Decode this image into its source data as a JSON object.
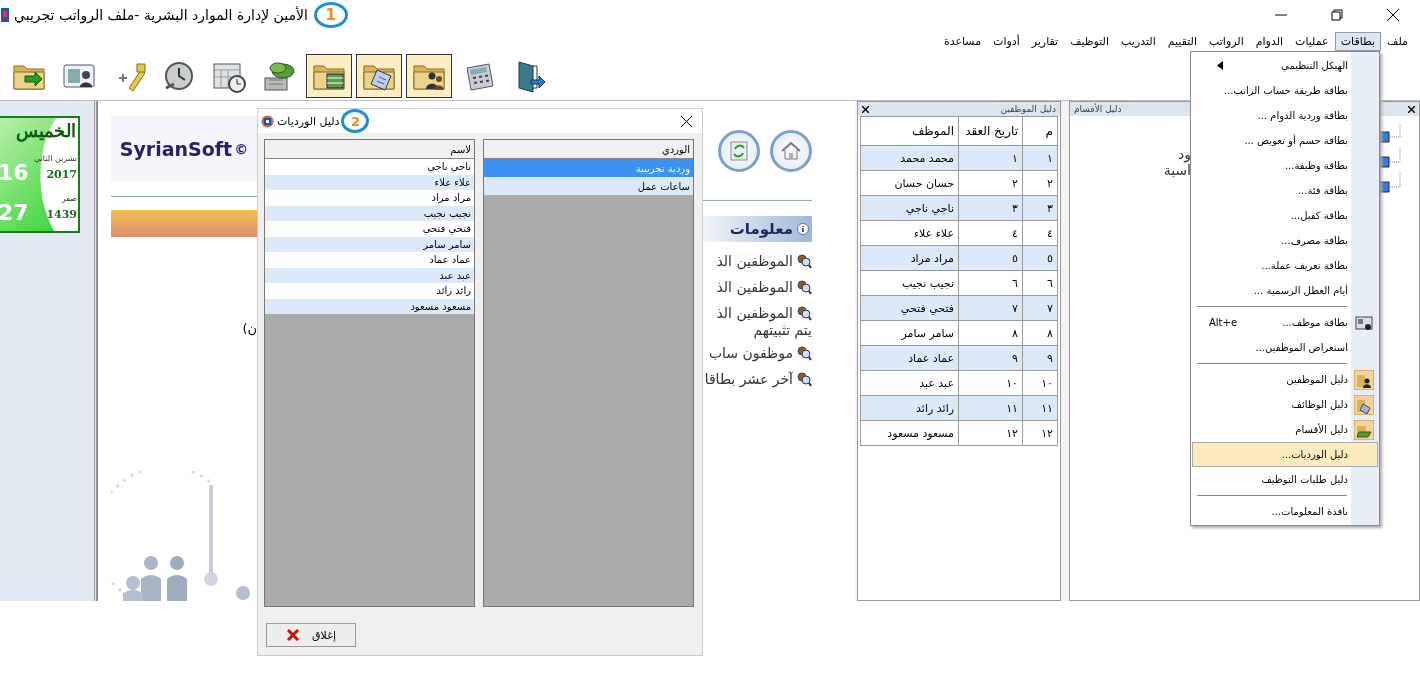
{
  "window": {
    "title": "الأمين لإدارة الموارد البشرية -ملف الرواتب تجريبي",
    "badge": "1"
  },
  "menu": [
    {
      "label": "ملف",
      "selected": false
    },
    {
      "label": "بطاقات",
      "selected": true
    },
    {
      "label": "عمليات",
      "selected": false
    },
    {
      "label": "الدوام",
      "selected": false
    },
    {
      "label": "الرواتب",
      "selected": false
    },
    {
      "label": "التقييم",
      "selected": false
    },
    {
      "label": "التدريب",
      "selected": false
    },
    {
      "label": "التوظيف",
      "selected": false
    },
    {
      "label": "تقارير",
      "selected": false
    },
    {
      "label": "أدوات",
      "selected": false
    },
    {
      "label": "مساعدة",
      "selected": false
    }
  ],
  "toolbar": [
    {
      "pressed": false
    },
    {
      "pressed": false
    },
    {
      "pressed": false
    },
    {
      "pressed": false
    },
    {
      "pressed": false
    },
    {
      "pressed": false
    },
    {
      "pressed": true
    },
    {
      "pressed": true
    },
    {
      "pressed": true
    },
    {
      "pressed": false
    },
    {
      "pressed": false
    }
  ],
  "calendar": {
    "weekday": "الخميس",
    "greg_day": "16",
    "greg_month": "تشرين الثاني",
    "greg_year": "2017",
    "hijri_day": "27",
    "hijri_month": "صفر",
    "hijri_year": "1439"
  },
  "home": {
    "logo": "SyrianSoft",
    "logo_mark": "©",
    "note": "(ن",
    "info_title": "معلومات",
    "links": [
      {
        "text": "الموظفين الذ",
        "kind": "link"
      },
      {
        "text": "الموظفين الذ",
        "kind": "link"
      },
      {
        "text": "الموظفين الذ",
        "kind": "link"
      },
      {
        "text": "يتم تثبيتهم",
        "kind": "continuation"
      },
      {
        "text": "موظفون ساب",
        "kind": "link"
      },
      {
        "text": "آخر عشر بطاقا",
        "kind": "link"
      }
    ]
  },
  "employees": {
    "title": "دليل الموظفين",
    "columns": [
      "م",
      "تاريخ العقد",
      "الموظف"
    ],
    "rows": [
      [
        "١",
        "١",
        "محمد محمد"
      ],
      [
        "٢",
        "٢",
        "حسان حسان"
      ],
      [
        "٣",
        "٣",
        "ناجي ناجي"
      ],
      [
        "٤",
        "٤",
        "علاء علاء"
      ],
      [
        "٥",
        "٥",
        "مراد مراد"
      ],
      [
        "٦",
        "٦",
        "نجيب نجيب"
      ],
      [
        "٧",
        "٧",
        "فتحي فتحي"
      ],
      [
        "٨",
        "٨",
        "سامر سامر"
      ],
      [
        "٩",
        "٩",
        "عماد عماد"
      ],
      [
        "١٠",
        "١٠",
        "عبد عبد"
      ],
      [
        "١١",
        "١١",
        "رائد رائد"
      ],
      [
        "١٢",
        "١٢",
        "مسعود مسعود"
      ]
    ]
  },
  "sections": {
    "title": "دليل الأقسام",
    "texts": [
      "ود",
      "اسبة"
    ]
  },
  "dropdown": [
    {
      "kind": "submenu",
      "label": "الهيكل التنظيمي",
      "selected": false
    },
    {
      "kind": "item",
      "label": "بطاقة طريقة حساب الراتب...",
      "selected": false
    },
    {
      "kind": "item",
      "label": "بطاقة وردية الدوام ...",
      "selected": false
    },
    {
      "kind": "item",
      "label": "بطاقة حسم أو تعويض ...",
      "selected": false
    },
    {
      "kind": "item",
      "label": "بطاقة وظيفة...",
      "selected": false
    },
    {
      "kind": "item",
      "label": "بطاقة فئة...",
      "selected": false
    },
    {
      "kind": "item",
      "label": "بطاقة كفيل...",
      "selected": false
    },
    {
      "kind": "item",
      "label": "بطاقة مصرف...",
      "selected": false
    },
    {
      "kind": "item",
      "label": "بطاقة تعريف عملة...",
      "selected": false
    },
    {
      "kind": "item",
      "label": "أيام العطل الرسمية ...",
      "selected": false
    },
    {
      "kind": "separator"
    },
    {
      "kind": "icon-item",
      "label": "بطاقة موظف...",
      "shortcut": "Alt+e",
      "selected": false
    },
    {
      "kind": "item",
      "label": "استعراض الموظفين...",
      "selected": false
    },
    {
      "kind": "separator"
    },
    {
      "kind": "icon-item",
      "label": "دليل الموظفين",
      "selected": false
    },
    {
      "kind": "icon-item",
      "label": "دليل الوظائف",
      "selected": false
    },
    {
      "kind": "icon-item",
      "label": "دليل الأقسام",
      "selected": false
    },
    {
      "kind": "item",
      "label": "دليل الورديات...",
      "selected": true
    },
    {
      "kind": "item",
      "label": "دليل طلبات التوظيف",
      "selected": false
    },
    {
      "kind": "separator"
    },
    {
      "kind": "item",
      "label": "نافذة المعلومات...",
      "selected": false
    }
  ],
  "dialog": {
    "title": "دليل الورديات",
    "badge": "2",
    "names": {
      "header": "لاسم",
      "rows": [
        "ناجي ناجي",
        "علاء علاء",
        "مراد مراد",
        "نجيب نجيب",
        "فتحي فتحي",
        "سامر سامر",
        "عماد عماد",
        "عبد عبد",
        "رائد رائد",
        "مسعود مسعود"
      ]
    },
    "shifts": {
      "header": "الوردي",
      "rows": [
        {
          "label": "وردية تجريبية",
          "selected": true
        },
        {
          "label": "ساعات عمل",
          "selected": false
        }
      ]
    },
    "close_button": "إغلاق"
  }
}
